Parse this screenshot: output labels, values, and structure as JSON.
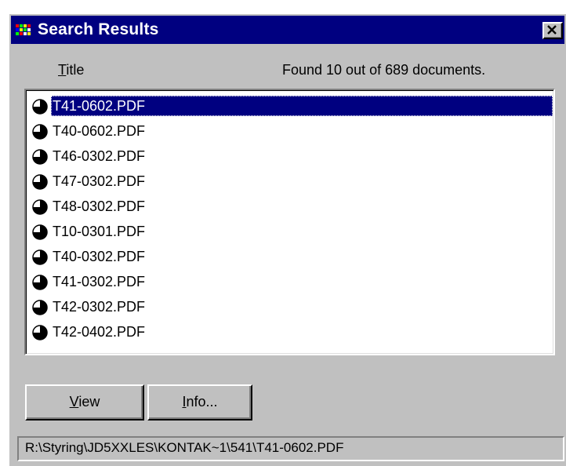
{
  "window": {
    "title": "Search Results",
    "close_label": "×"
  },
  "header": {
    "column_title_first": "T",
    "column_title_rest": "itle",
    "found_text": "Found 10 out of 689 documents."
  },
  "results": {
    "selected_index": 0,
    "items": [
      {
        "label": "T41-0602.PDF",
        "icon": "relevance-pie-icon"
      },
      {
        "label": "T40-0602.PDF",
        "icon": "relevance-pie-icon"
      },
      {
        "label": "T46-0302.PDF",
        "icon": "relevance-pie-icon"
      },
      {
        "label": "T47-0302.PDF",
        "icon": "relevance-pie-icon"
      },
      {
        "label": "T48-0302.PDF",
        "icon": "relevance-pie-icon"
      },
      {
        "label": "T10-0301.PDF",
        "icon": "relevance-pie-icon"
      },
      {
        "label": "T40-0302.PDF",
        "icon": "relevance-pie-icon"
      },
      {
        "label": "T41-0302.PDF",
        "icon": "relevance-pie-icon"
      },
      {
        "label": "T42-0302.PDF",
        "icon": "relevance-pie-icon"
      },
      {
        "label": "T42-0402.PDF",
        "icon": "relevance-pie-icon"
      }
    ]
  },
  "buttons": {
    "view_first": "V",
    "view_rest": "iew",
    "info_first": "I",
    "info_rest": "nfo..."
  },
  "status": {
    "path": "R:\\Styring\\JD5XXLES\\KONTAK~1\\541\\T41-0602.PDF"
  },
  "colors": {
    "titlebar": "#000080",
    "selection": "#000080",
    "face": "#c0c0c0"
  }
}
